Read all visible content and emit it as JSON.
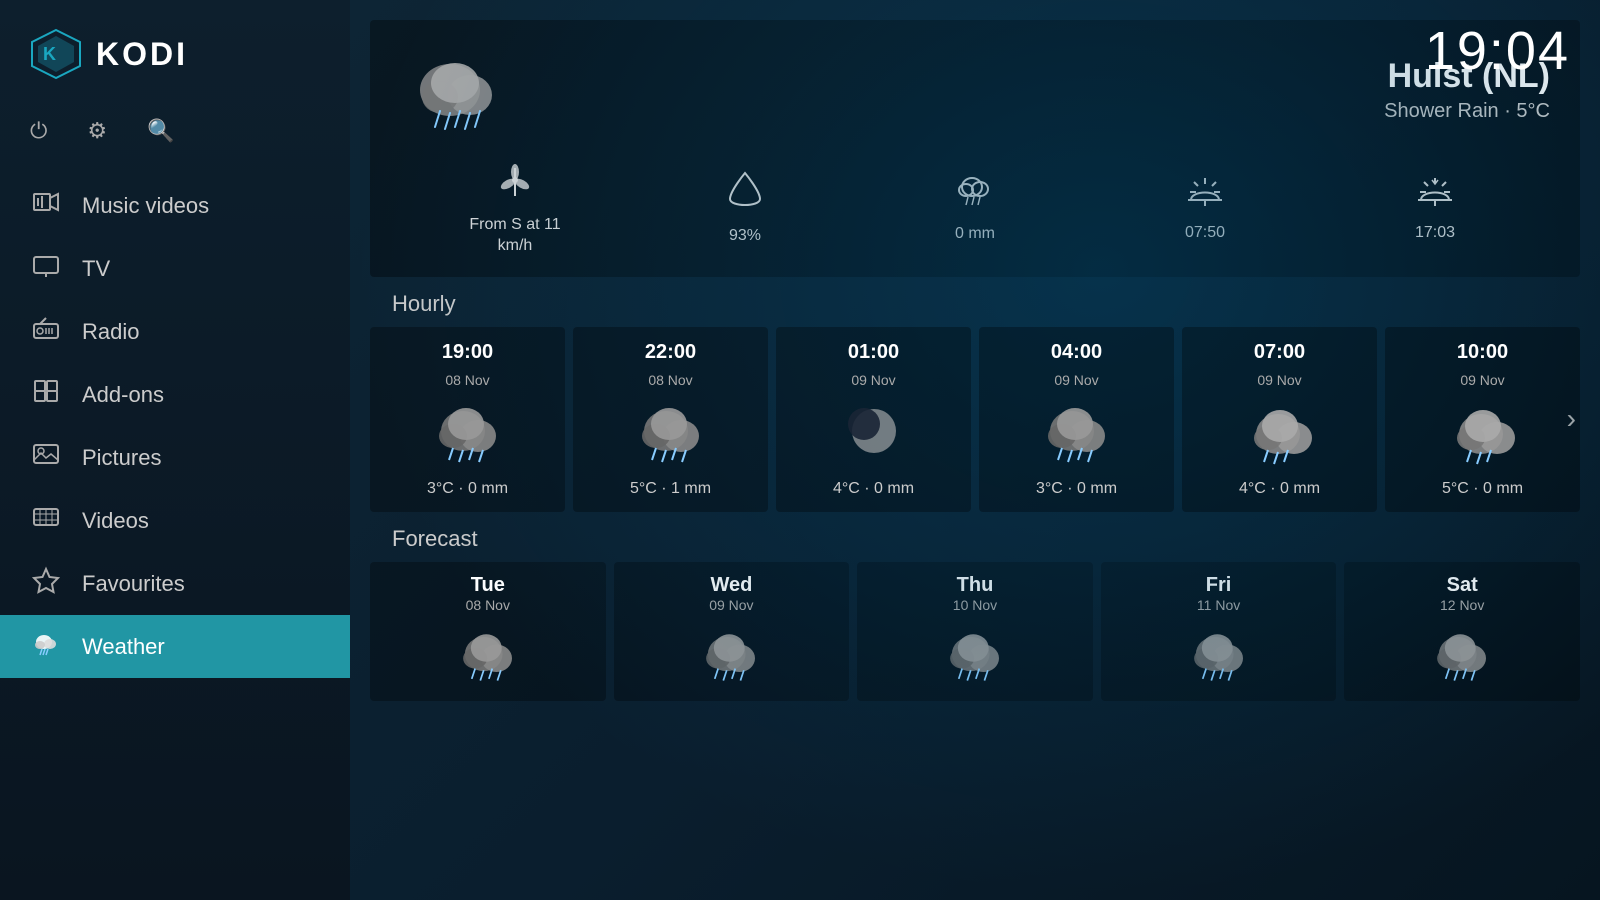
{
  "clock": "19:04",
  "logo": "KODI",
  "sidebar": {
    "top_icons": [
      {
        "name": "power-icon",
        "symbol": "⏻"
      },
      {
        "name": "settings-icon",
        "symbol": "⚙"
      },
      {
        "name": "search-icon",
        "symbol": "🔍"
      }
    ],
    "nav_items": [
      {
        "id": "music-videos",
        "label": "Music videos",
        "icon": "♫",
        "active": false
      },
      {
        "id": "tv",
        "label": "TV",
        "icon": "📺",
        "active": false
      },
      {
        "id": "radio",
        "label": "Radio",
        "icon": "📻",
        "active": false
      },
      {
        "id": "add-ons",
        "label": "Add-ons",
        "icon": "📦",
        "active": false
      },
      {
        "id": "pictures",
        "label": "Pictures",
        "icon": "🖼",
        "active": false
      },
      {
        "id": "videos",
        "label": "Videos",
        "icon": "🎞",
        "active": false
      },
      {
        "id": "favourites",
        "label": "Favourites",
        "icon": "★",
        "active": false
      },
      {
        "id": "weather",
        "label": "Weather",
        "icon": "🌧",
        "active": true
      }
    ]
  },
  "weather": {
    "location": "Hulst (NL)",
    "description": "Shower Rain · 5°C",
    "stats": [
      {
        "label": "From S at 11\nkm/h",
        "icon_name": "wind-icon"
      },
      {
        "label": "93%",
        "icon_name": "humidity-icon"
      },
      {
        "label": "0 mm",
        "icon_name": "rain-icon"
      },
      {
        "label": "07:50",
        "icon_name": "sunrise-icon"
      },
      {
        "label": "17:03",
        "icon_name": "sunset-icon"
      }
    ],
    "hourly_title": "Hourly",
    "hourly": [
      {
        "time": "19:00",
        "date": "08 Nov",
        "temp_rain": "3°C · 0 mm",
        "icon": "shower_night"
      },
      {
        "time": "22:00",
        "date": "08 Nov",
        "temp_rain": "5°C · 1 mm",
        "icon": "shower_night"
      },
      {
        "time": "01:00",
        "date": "09 Nov",
        "temp_rain": "4°C · 0 mm",
        "icon": "clear_night"
      },
      {
        "time": "04:00",
        "date": "09 Nov",
        "temp_rain": "3°C · 0 mm",
        "icon": "shower_night"
      },
      {
        "time": "07:00",
        "date": "09 Nov",
        "temp_rain": "4°C · 0 mm",
        "icon": "shower_day"
      },
      {
        "time": "10:00",
        "date": "09 Nov",
        "temp_rain": "5°C · 0 mm",
        "icon": "shower_day"
      }
    ],
    "forecast_title": "Forecast",
    "forecast": [
      {
        "day": "Tue",
        "date": "08 Nov"
      },
      {
        "day": "Wed",
        "date": "09 Nov"
      },
      {
        "day": "Thu",
        "date": "10 Nov"
      },
      {
        "day": "Fri",
        "date": "11 Nov"
      },
      {
        "day": "Sat",
        "date": "12 Nov"
      }
    ]
  }
}
